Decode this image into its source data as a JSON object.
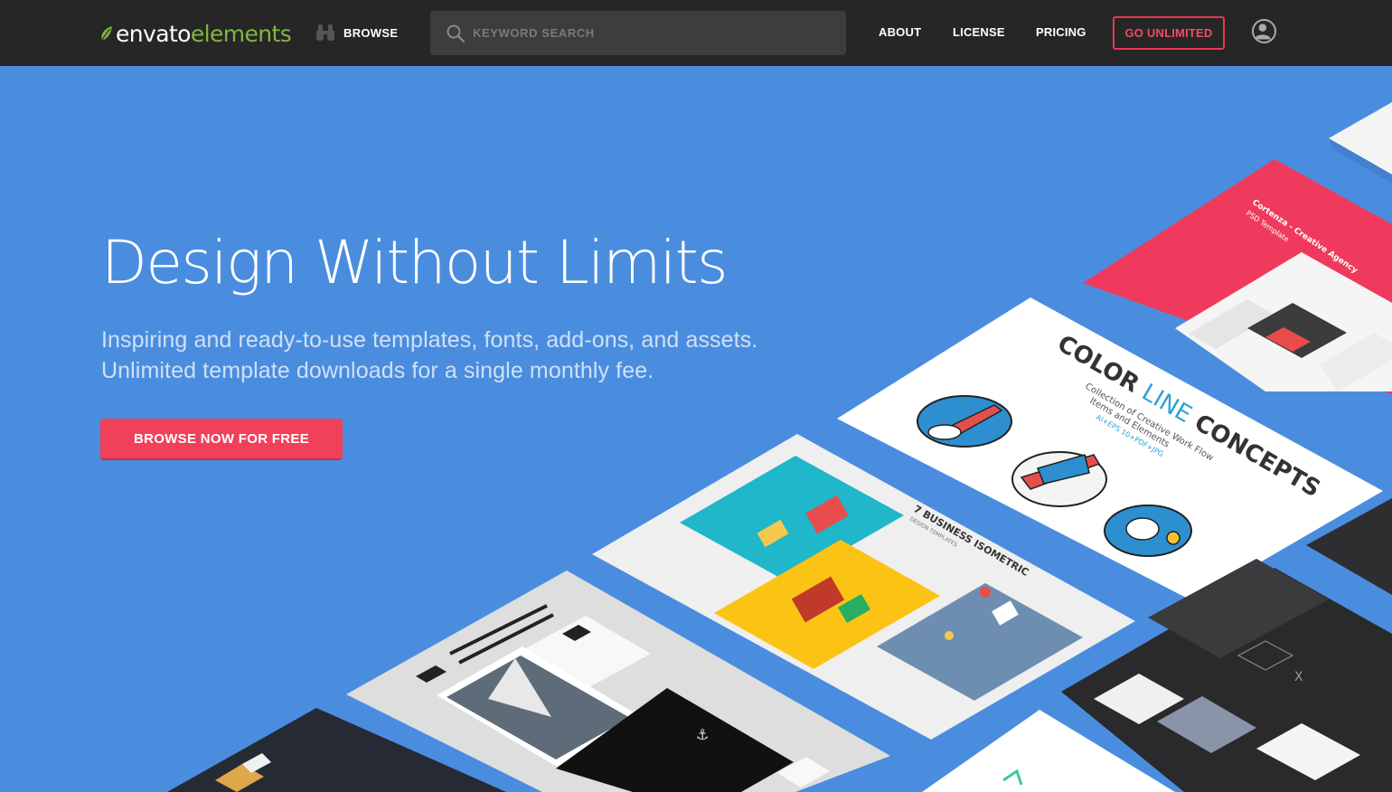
{
  "header": {
    "logo": {
      "word1": "envato",
      "word2": "elements",
      "icon": "leaf-icon"
    },
    "browse": {
      "label": "BROWSE",
      "icon": "binoculars-icon"
    },
    "search": {
      "placeholder": "KEYWORD SEARCH",
      "value": "",
      "icon": "search-icon"
    },
    "nav": [
      {
        "label": "ABOUT"
      },
      {
        "label": "LICENSE"
      },
      {
        "label": "PRICING"
      }
    ],
    "cta_label": "GO UNLIMITED",
    "avatar_icon": "user-avatar-icon"
  },
  "hero": {
    "title": "Design Without Limits",
    "subtitle_line1": "Inspiring and ready-to-use templates, fonts, add-ons, and assets.",
    "subtitle_line2": "Unlimited template downloads for a single monthly fee.",
    "cta_label": "BROWSE NOW FOR FREE"
  },
  "showcase": {
    "card_red": {
      "title": "Cortenza - Creative Agency",
      "subtitle": "PSD Template"
    },
    "card_colorline": {
      "word1": "COLOR",
      "word2": "LINE",
      "word3": "CONCEPTS",
      "subtitle1": "Collection of Creative Work Flow",
      "subtitle2": "Items and Elements",
      "formats": "AI+EPS 10+PDF+JPG"
    },
    "card_isometric": {
      "title": "7 BUSINESS ISOMETRIC",
      "subtitle": "DESIGN TEMPLATES"
    },
    "card_dark": {
      "text": "X"
    }
  },
  "colors": {
    "hero_bg": "#4a8ddf",
    "topbar_bg": "#262626",
    "brand_green": "#82b541",
    "accent_red": "#f1415a"
  }
}
